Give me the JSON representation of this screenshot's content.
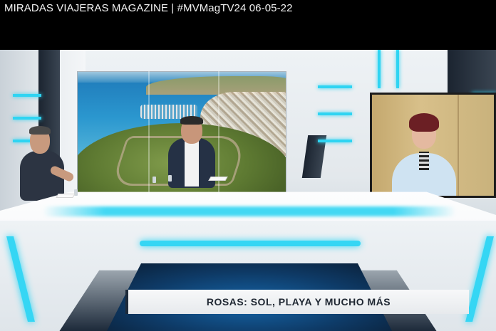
{
  "video": {
    "title": "MIRADAS VIAJERAS MAGAZINE | #MVMagTV24 06-05-22"
  },
  "caption": {
    "text": "ROSAS: SOL, PLAYA Y MUCHO MÁS"
  },
  "colors": {
    "accent_cyan": "#2fd4f2",
    "caption_text": "#202833",
    "caption_bg": "#f7f8f9",
    "player_bg": "#000000"
  }
}
